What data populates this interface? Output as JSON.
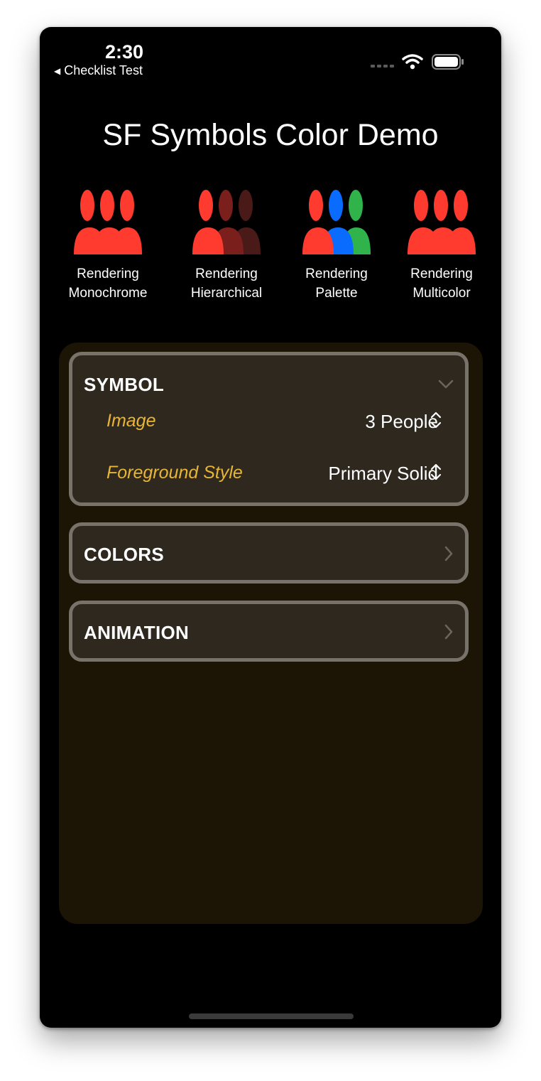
{
  "status_bar": {
    "time": "2:30",
    "back_label": "Checklist Test"
  },
  "title": "SF Symbols Color Demo",
  "renderings": [
    {
      "label": "Rendering\nMonochrome",
      "colors": [
        "#ff3b30",
        "#ff3b30",
        "#ff3b30"
      ],
      "icon": "three-people-icon"
    },
    {
      "label": "Rendering\nHierarchical",
      "colors": [
        "#ff3b30",
        "#7a1f1b",
        "#4a1a18"
      ],
      "icon": "three-people-icon"
    },
    {
      "label": "Rendering\nPalette",
      "colors": [
        "#ff3b30",
        "#0a6cff",
        "#2fb34a"
      ],
      "icon": "three-people-icon"
    },
    {
      "label": "Rendering\nMulticolor",
      "colors": [
        "#ff3b30",
        "#ff3b30",
        "#ff3b30"
      ],
      "icon": "three-people-icon"
    }
  ],
  "sections": {
    "symbol": {
      "title": "SYMBOL",
      "expanded": true,
      "rows": [
        {
          "label": "Image",
          "value": "3 People"
        },
        {
          "label": "Foreground Style",
          "value": "Primary Solid"
        }
      ]
    },
    "colors": {
      "title": "COLORS",
      "expanded": false
    },
    "animation": {
      "title": "ANIMATION",
      "expanded": false
    }
  },
  "theme": {
    "accent": "#e8b634",
    "panel_bg": "#1c1505",
    "section_bg": "#2e281f",
    "section_border": "#77736a"
  }
}
